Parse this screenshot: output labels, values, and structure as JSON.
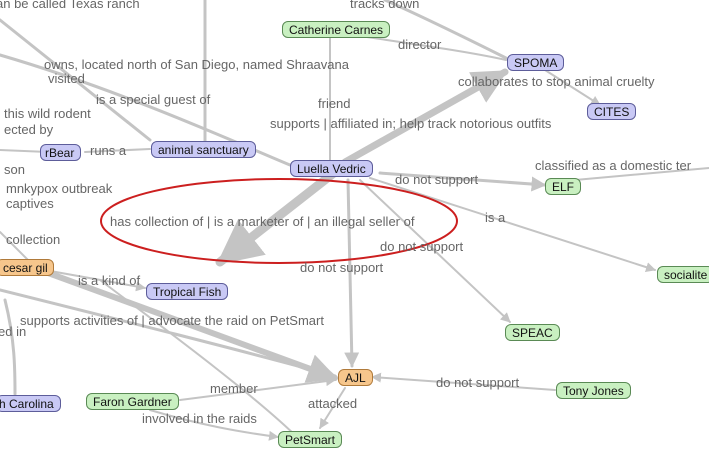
{
  "nodes": {
    "catherine_carnes": {
      "label": "Catherine Carnes",
      "color": "green"
    },
    "spoma": {
      "label": "SPOMA",
      "color": "blue"
    },
    "cites": {
      "label": "CITES",
      "color": "blue"
    },
    "animal_sanctuary": {
      "label": "animal sanctuary",
      "color": "blue"
    },
    "rbear": {
      "label": "rBear",
      "color": "blue"
    },
    "luella_vedric": {
      "label": "Luella Vedric",
      "color": "blue"
    },
    "elf": {
      "label": "ELF",
      "color": "green"
    },
    "socialite": {
      "label": "socialite",
      "color": "green"
    },
    "cesar_gil": {
      "label": "cesar gil",
      "color": "orange"
    },
    "tropical_fish": {
      "label": "Tropical Fish",
      "color": "blue"
    },
    "speac": {
      "label": "SPEAC",
      "color": "green"
    },
    "ajl": {
      "label": "AJL",
      "color": "orange"
    },
    "tony_jones": {
      "label": "Tony Jones",
      "color": "green"
    },
    "faron_gardner": {
      "label": "Faron Gardner",
      "color": "green"
    },
    "petsmart": {
      "label": "PetSmart",
      "color": "green"
    },
    "h_carolina": {
      "label": "h Carolina",
      "color": "blue"
    }
  },
  "edge_labels": {
    "be_called_texas": "an be called  Texas ranch",
    "tracks_down": "tracks down",
    "director": "director",
    "owns_located": "owns, located north of San Diego, named Shraavana",
    "visited": "visited",
    "collaborates": "collaborates to stop animal cruelty",
    "is_special_guest": "is a special guest of",
    "this_wild_rodent": "this wild rodent",
    "ected_by": "ected by",
    "friend": "friend",
    "supports_affiliated": "supports | affiliated in; help track notorious outfits",
    "runs_a": "runs a",
    "son": "son",
    "classified_domestic": "classified as a domestic ter",
    "mnkypox": "mnkypox outbreak",
    "do_not_support_1": "do not support",
    "captives": "captives",
    "has_collection": "has collection of | is a marketer of | an illegal seller of",
    "is_a": "is a",
    "collection": "collection",
    "do_not_support_2": "do not support",
    "do_not_support_3": "do not support",
    "is_a_kind_of": "is a kind of",
    "supports_activities": "supports activities of | advocate the raid on PetSmart",
    "ed_in": "ed in",
    "member": "member",
    "do_not_support_4": "do not support",
    "attacked": "attacked",
    "involved_in_raids": "involved in the raids"
  },
  "colors": {
    "node_green": "#c9f0c1",
    "node_blue": "#c9c9f5",
    "node_orange": "#f6c68c",
    "edge": "#c4c4c4",
    "edge_label": "#666666",
    "highlight_ellipse": "#cc1f1f"
  }
}
